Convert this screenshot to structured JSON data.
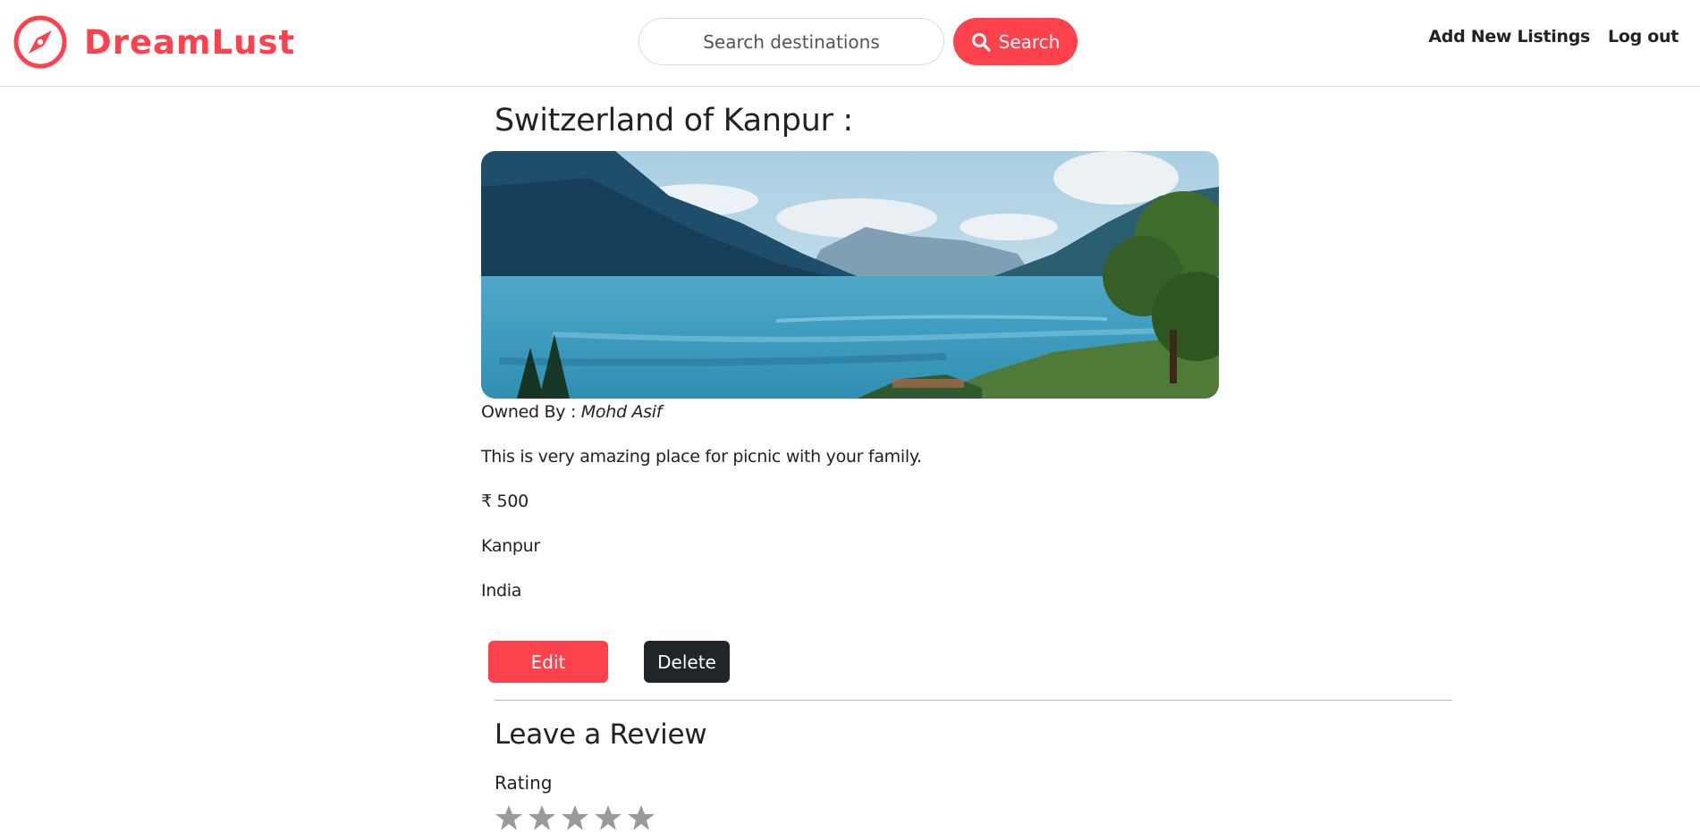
{
  "navbar": {
    "brand_name": "DreamLust",
    "brand_icon": "compass-icon",
    "search_placeholder": "Search destinations",
    "search_button_label": "Search",
    "search_icon": "magnifier-icon",
    "links": [
      "Add New Listings",
      "Log out"
    ]
  },
  "listing": {
    "title": "Switzerland of Kanpur :",
    "image": "lake-mountain-landscape",
    "owner_prefix": "Owned By :",
    "owner_name": "Mohd Asif",
    "description": "This is very amazing place for picnic with your family.",
    "price": "₹ 500",
    "location": "Kanpur",
    "country": "India",
    "edit_label": "Edit",
    "delete_label": "Delete"
  },
  "review": {
    "heading": "Leave a Review",
    "rating_label": "Rating",
    "star_icon": "star-icon",
    "star_count": 5
  },
  "colors": {
    "brand": "#fe424d",
    "dark_button": "#212529",
    "text": "#222222",
    "border": "#dcdcdc"
  }
}
